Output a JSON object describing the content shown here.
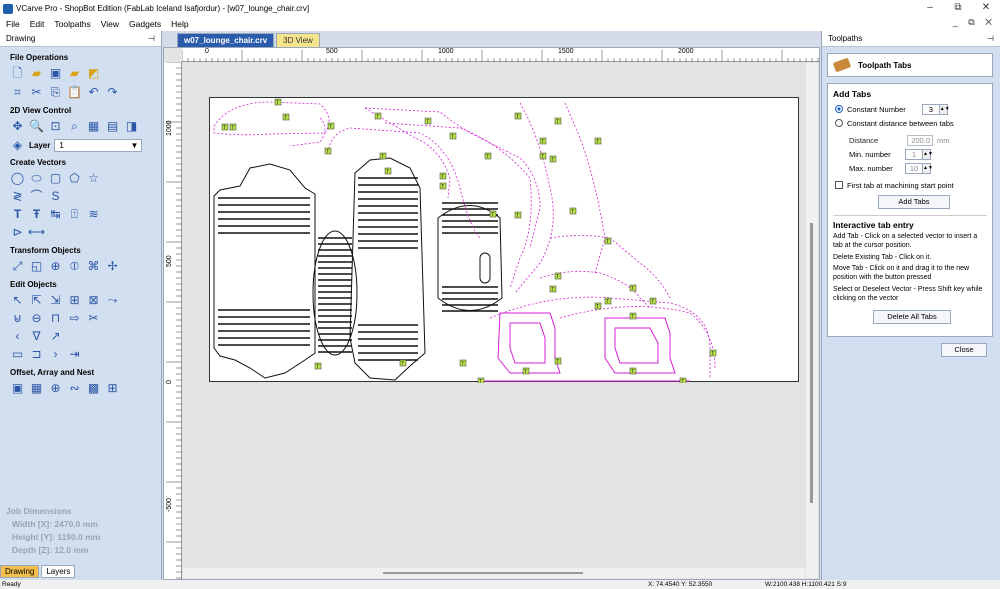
{
  "window": {
    "title": "VCarve Pro - ShopBot Edition (FabLab Iceland Isafjordur) - [w07_lounge_chair.crv]",
    "minimize": "–",
    "restore": "⧉",
    "close": "✕"
  },
  "menu": [
    "File",
    "Edit",
    "Toolpaths",
    "View",
    "Gadgets",
    "Help"
  ],
  "mdi_controls": "_ ⧉ ✕",
  "left_panel": {
    "header": "Drawing",
    "pin": "⊣",
    "sections": {
      "file_operations": "File Operations",
      "view_control": "2D View Control",
      "layer_label": "Layer",
      "layer_value": "1",
      "create_vectors": "Create Vectors",
      "transform_objects": "Transform Objects",
      "edit_objects": "Edit Objects",
      "offset_array_nest": "Offset, Array and Nest"
    },
    "job_dimensions": {
      "title": "Job Dimensions",
      "width": "Width  [X]: 2470.0 mm",
      "height": "Height [Y]: 1190.0 mm",
      "depth": "Depth  [Z]: 12.0 mm"
    },
    "bottom_tabs": [
      "Drawing",
      "Layers"
    ]
  },
  "document_tabs": [
    "w07_lounge_chair.crv",
    "3D View"
  ],
  "doc_controls": "◁ ▷ ✕",
  "rulers": {
    "h_labels": [
      "0",
      "500",
      "1000",
      "1500",
      "2000"
    ],
    "v_labels": [
      "1000",
      "500",
      "0",
      "-500"
    ]
  },
  "right_panel": {
    "header": "Toolpaths",
    "pin": "⊣",
    "toolpath_title": "Toolpath Tabs",
    "add_tabs": {
      "heading": "Add Tabs",
      "constant_number": "Constant Number",
      "constant_number_value": "3",
      "constant_distance": "Constant distance between tabs",
      "distance_label": "Distance",
      "distance_value": "200.0",
      "distance_unit": "mm",
      "min_label": "Min. number",
      "min_value": "1",
      "max_label": "Max. number",
      "max_value": "10",
      "first_tab": "First tab at machining start point",
      "add_button": "Add Tabs"
    },
    "interactive": {
      "heading": "Interactive tab entry",
      "line1": "Add Tab - Click on a selected vector to insert a tab at the cursor position.",
      "line2": "Delete Existing Tab - Click on it.",
      "line3": "Move Tab - Click on it and drag it to the new position with the button pressed",
      "line4": "Select or Deselect Vector - Press Shift key while clicking on the vector",
      "delete_button": "Delete All Tabs"
    },
    "close_button": "Close"
  },
  "status": {
    "ready": "Ready",
    "coords": "X: 74.4540 Y: 52.3550",
    "dims": "W:2100.438  H:1100.421  S:9"
  }
}
